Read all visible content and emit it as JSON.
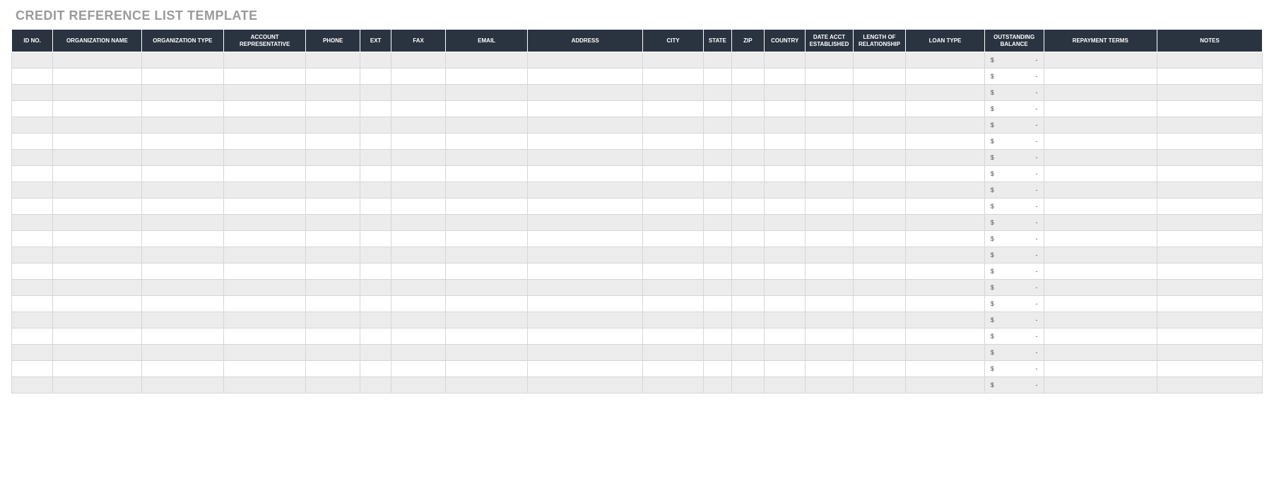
{
  "title": "CREDIT REFERENCE LIST TEMPLATE",
  "columns": [
    "ID NO.",
    "ORGANIZATION NAME",
    "ORGANIZATION TYPE",
    "ACCOUNT REPRESENTATIVE",
    "PHONE",
    "EXT",
    "FAX",
    "EMAIL",
    "ADDRESS",
    "CITY",
    "STATE",
    "ZIP",
    "COUNTRY",
    "DATE ACCT ESTABLISHED",
    "LENGTH OF RELATIONSHIP",
    "LOAN TYPE",
    "OUTSTANDING BALANCE",
    "REPAYMENT TERMS",
    "NOTES"
  ],
  "balance_currency": "$",
  "balance_placeholder": "-",
  "row_count": 21,
  "rows": [
    {
      "id": "",
      "org_name": "",
      "org_type": "",
      "acct_rep": "",
      "phone": "",
      "ext": "",
      "fax": "",
      "email": "",
      "address": "",
      "city": "",
      "state": "",
      "zip": "",
      "country": "",
      "date_acct": "",
      "length": "",
      "loan_type": "",
      "balance": "",
      "repay": "",
      "notes": ""
    },
    {
      "id": "",
      "org_name": "",
      "org_type": "",
      "acct_rep": "",
      "phone": "",
      "ext": "",
      "fax": "",
      "email": "",
      "address": "",
      "city": "",
      "state": "",
      "zip": "",
      "country": "",
      "date_acct": "",
      "length": "",
      "loan_type": "",
      "balance": "",
      "repay": "",
      "notes": ""
    },
    {
      "id": "",
      "org_name": "",
      "org_type": "",
      "acct_rep": "",
      "phone": "",
      "ext": "",
      "fax": "",
      "email": "",
      "address": "",
      "city": "",
      "state": "",
      "zip": "",
      "country": "",
      "date_acct": "",
      "length": "",
      "loan_type": "",
      "balance": "",
      "repay": "",
      "notes": ""
    },
    {
      "id": "",
      "org_name": "",
      "org_type": "",
      "acct_rep": "",
      "phone": "",
      "ext": "",
      "fax": "",
      "email": "",
      "address": "",
      "city": "",
      "state": "",
      "zip": "",
      "country": "",
      "date_acct": "",
      "length": "",
      "loan_type": "",
      "balance": "",
      "repay": "",
      "notes": ""
    },
    {
      "id": "",
      "org_name": "",
      "org_type": "",
      "acct_rep": "",
      "phone": "",
      "ext": "",
      "fax": "",
      "email": "",
      "address": "",
      "city": "",
      "state": "",
      "zip": "",
      "country": "",
      "date_acct": "",
      "length": "",
      "loan_type": "",
      "balance": "",
      "repay": "",
      "notes": ""
    },
    {
      "id": "",
      "org_name": "",
      "org_type": "",
      "acct_rep": "",
      "phone": "",
      "ext": "",
      "fax": "",
      "email": "",
      "address": "",
      "city": "",
      "state": "",
      "zip": "",
      "country": "",
      "date_acct": "",
      "length": "",
      "loan_type": "",
      "balance": "",
      "repay": "",
      "notes": ""
    },
    {
      "id": "",
      "org_name": "",
      "org_type": "",
      "acct_rep": "",
      "phone": "",
      "ext": "",
      "fax": "",
      "email": "",
      "address": "",
      "city": "",
      "state": "",
      "zip": "",
      "country": "",
      "date_acct": "",
      "length": "",
      "loan_type": "",
      "balance": "",
      "repay": "",
      "notes": ""
    },
    {
      "id": "",
      "org_name": "",
      "org_type": "",
      "acct_rep": "",
      "phone": "",
      "ext": "",
      "fax": "",
      "email": "",
      "address": "",
      "city": "",
      "state": "",
      "zip": "",
      "country": "",
      "date_acct": "",
      "length": "",
      "loan_type": "",
      "balance": "",
      "repay": "",
      "notes": ""
    },
    {
      "id": "",
      "org_name": "",
      "org_type": "",
      "acct_rep": "",
      "phone": "",
      "ext": "",
      "fax": "",
      "email": "",
      "address": "",
      "city": "",
      "state": "",
      "zip": "",
      "country": "",
      "date_acct": "",
      "length": "",
      "loan_type": "",
      "balance": "",
      "repay": "",
      "notes": ""
    },
    {
      "id": "",
      "org_name": "",
      "org_type": "",
      "acct_rep": "",
      "phone": "",
      "ext": "",
      "fax": "",
      "email": "",
      "address": "",
      "city": "",
      "state": "",
      "zip": "",
      "country": "",
      "date_acct": "",
      "length": "",
      "loan_type": "",
      "balance": "",
      "repay": "",
      "notes": ""
    },
    {
      "id": "",
      "org_name": "",
      "org_type": "",
      "acct_rep": "",
      "phone": "",
      "ext": "",
      "fax": "",
      "email": "",
      "address": "",
      "city": "",
      "state": "",
      "zip": "",
      "country": "",
      "date_acct": "",
      "length": "",
      "loan_type": "",
      "balance": "",
      "repay": "",
      "notes": ""
    },
    {
      "id": "",
      "org_name": "",
      "org_type": "",
      "acct_rep": "",
      "phone": "",
      "ext": "",
      "fax": "",
      "email": "",
      "address": "",
      "city": "",
      "state": "",
      "zip": "",
      "country": "",
      "date_acct": "",
      "length": "",
      "loan_type": "",
      "balance": "",
      "repay": "",
      "notes": ""
    },
    {
      "id": "",
      "org_name": "",
      "org_type": "",
      "acct_rep": "",
      "phone": "",
      "ext": "",
      "fax": "",
      "email": "",
      "address": "",
      "city": "",
      "state": "",
      "zip": "",
      "country": "",
      "date_acct": "",
      "length": "",
      "loan_type": "",
      "balance": "",
      "repay": "",
      "notes": ""
    },
    {
      "id": "",
      "org_name": "",
      "org_type": "",
      "acct_rep": "",
      "phone": "",
      "ext": "",
      "fax": "",
      "email": "",
      "address": "",
      "city": "",
      "state": "",
      "zip": "",
      "country": "",
      "date_acct": "",
      "length": "",
      "loan_type": "",
      "balance": "",
      "repay": "",
      "notes": ""
    },
    {
      "id": "",
      "org_name": "",
      "org_type": "",
      "acct_rep": "",
      "phone": "",
      "ext": "",
      "fax": "",
      "email": "",
      "address": "",
      "city": "",
      "state": "",
      "zip": "",
      "country": "",
      "date_acct": "",
      "length": "",
      "loan_type": "",
      "balance": "",
      "repay": "",
      "notes": ""
    },
    {
      "id": "",
      "org_name": "",
      "org_type": "",
      "acct_rep": "",
      "phone": "",
      "ext": "",
      "fax": "",
      "email": "",
      "address": "",
      "city": "",
      "state": "",
      "zip": "",
      "country": "",
      "date_acct": "",
      "length": "",
      "loan_type": "",
      "balance": "",
      "repay": "",
      "notes": ""
    },
    {
      "id": "",
      "org_name": "",
      "org_type": "",
      "acct_rep": "",
      "phone": "",
      "ext": "",
      "fax": "",
      "email": "",
      "address": "",
      "city": "",
      "state": "",
      "zip": "",
      "country": "",
      "date_acct": "",
      "length": "",
      "loan_type": "",
      "balance": "",
      "repay": "",
      "notes": ""
    },
    {
      "id": "",
      "org_name": "",
      "org_type": "",
      "acct_rep": "",
      "phone": "",
      "ext": "",
      "fax": "",
      "email": "",
      "address": "",
      "city": "",
      "state": "",
      "zip": "",
      "country": "",
      "date_acct": "",
      "length": "",
      "loan_type": "",
      "balance": "",
      "repay": "",
      "notes": ""
    },
    {
      "id": "",
      "org_name": "",
      "org_type": "",
      "acct_rep": "",
      "phone": "",
      "ext": "",
      "fax": "",
      "email": "",
      "address": "",
      "city": "",
      "state": "",
      "zip": "",
      "country": "",
      "date_acct": "",
      "length": "",
      "loan_type": "",
      "balance": "",
      "repay": "",
      "notes": ""
    },
    {
      "id": "",
      "org_name": "",
      "org_type": "",
      "acct_rep": "",
      "phone": "",
      "ext": "",
      "fax": "",
      "email": "",
      "address": "",
      "city": "",
      "state": "",
      "zip": "",
      "country": "",
      "date_acct": "",
      "length": "",
      "loan_type": "",
      "balance": "",
      "repay": "",
      "notes": ""
    },
    {
      "id": "",
      "org_name": "",
      "org_type": "",
      "acct_rep": "",
      "phone": "",
      "ext": "",
      "fax": "",
      "email": "",
      "address": "",
      "city": "",
      "state": "",
      "zip": "",
      "country": "",
      "date_acct": "",
      "length": "",
      "loan_type": "",
      "balance": "",
      "repay": "",
      "notes": ""
    }
  ]
}
